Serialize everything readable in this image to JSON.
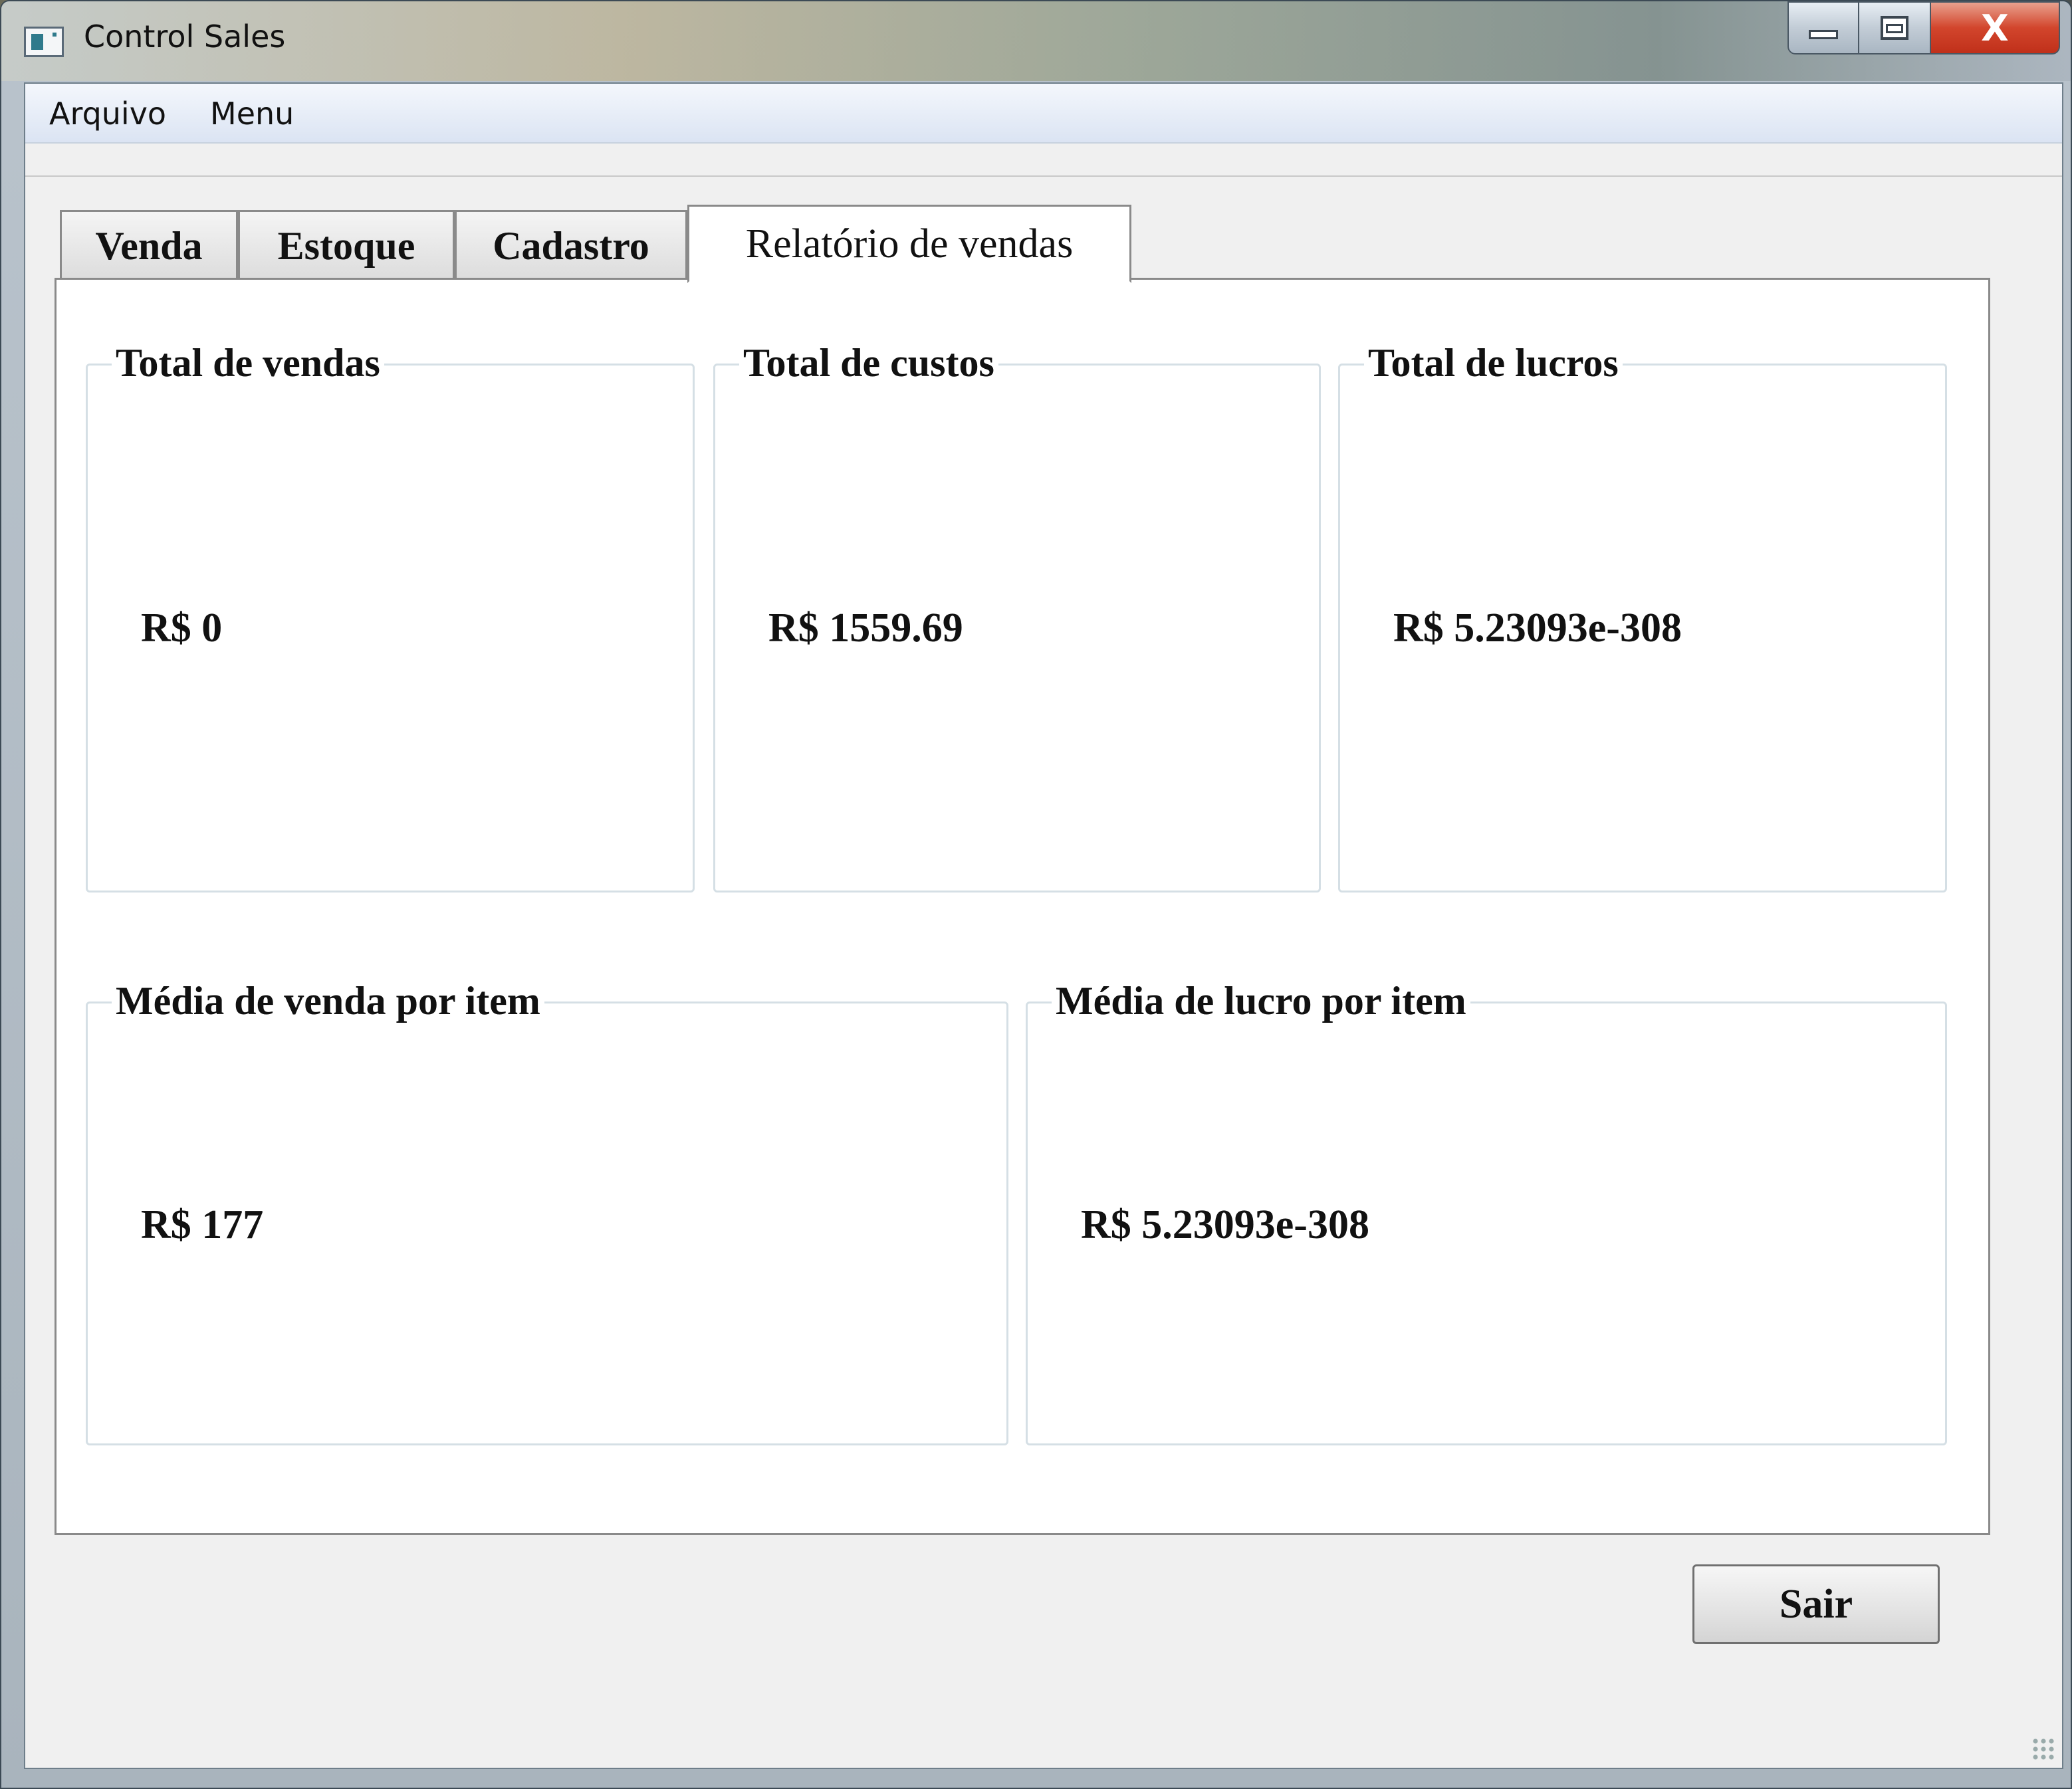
{
  "window": {
    "title": "Control Sales",
    "close_glyph": "X",
    "icons": [
      "app-icon",
      "minimize-icon",
      "maximize-icon",
      "close-icon"
    ]
  },
  "menubar": {
    "items": [
      "Arquivo",
      "Menu"
    ]
  },
  "tabs": [
    {
      "label": "Venda",
      "active": false
    },
    {
      "label": "Estoque",
      "active": false
    },
    {
      "label": "Cadastro",
      "active": false
    },
    {
      "label": "Relatório de vendas",
      "active": true
    }
  ],
  "report": {
    "total_vendas": {
      "title": "Total de vendas",
      "value": "R$ 0"
    },
    "total_custos": {
      "title": "Total de custos",
      "value": "R$ 1559.69"
    },
    "total_lucros": {
      "title": "Total de lucros",
      "value": "R$ 5.23093e-308"
    },
    "media_venda": {
      "title": "Média de venda por item",
      "value": "R$ 177"
    },
    "media_lucro": {
      "title": "Média de lucro por item",
      "value": "R$ 5.23093e-308"
    }
  },
  "buttons": {
    "exit_label": "Sair"
  }
}
